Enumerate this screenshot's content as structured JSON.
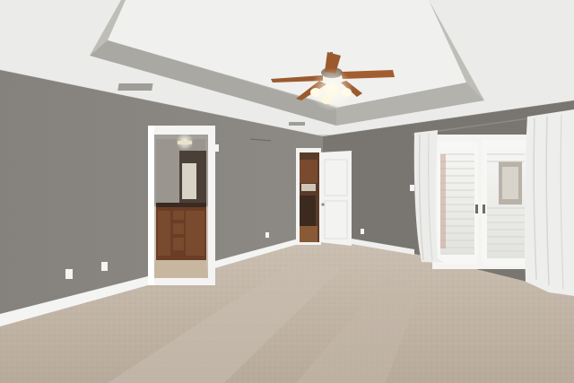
{
  "image": {
    "subject": "empty-bedroom-interior",
    "colors": {
      "ceiling": "#ececea",
      "tray_band": "#bdbcb7",
      "wall_gray": "#8a8782",
      "wall_dark": "#77746f",
      "baseboard": "#f4f4f2",
      "carpet": "#bfb3a5",
      "carpet_far": "#c8bcae",
      "door_white": "#f3f3f1",
      "cabinet_wood": "#6a3d26",
      "curtain": "#eeeeec",
      "fan_wood": "#9b5a2e",
      "fan_metal": "#8a7d70",
      "light_glow": "#fffbe8"
    },
    "objects": [
      "ceiling-fan-icon",
      "tray-ceiling",
      "bathroom-doorway",
      "closet-door",
      "french-doors",
      "curtain-left",
      "curtain-right",
      "outlet-icon",
      "light-switch-icon",
      "air-vent-icon"
    ]
  }
}
